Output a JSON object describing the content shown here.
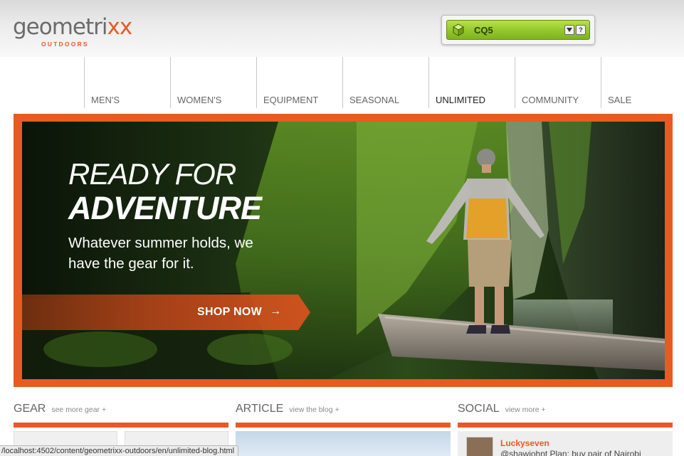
{
  "brand": {
    "logo_prefix": "geometri",
    "logo_suffix": "xx",
    "logo_sub": "OUTDOORS",
    "accent_color": "#e85a24"
  },
  "cq_widget": {
    "label": "CQ5",
    "icon": "cube-icon",
    "dropdown_icon": "chevron-down-icon",
    "help_label": "?"
  },
  "nav": {
    "items": [
      {
        "label": "MEN'S"
      },
      {
        "label": "WOMEN'S"
      },
      {
        "label": "EQUIPMENT"
      },
      {
        "label": "SEASONAL"
      },
      {
        "label": "UNLIMITED"
      },
      {
        "label": "COMMUNITY"
      },
      {
        "label": "SALE"
      }
    ]
  },
  "hero": {
    "line1": "READY FOR",
    "line2": "ADVENTURE",
    "tagline": "Whatever summer holds, we have the gear for it.",
    "cta_label": "SHOP NOW",
    "cta_icon": "arrow-right-icon",
    "cta_arrow": "→"
  },
  "sections": {
    "gear": {
      "title": "GEAR",
      "more": "see more gear +"
    },
    "article": {
      "title": "ARTICLE",
      "more": "view the blog +"
    },
    "social": {
      "title": "SOCIAL",
      "more": "view more +",
      "user": "Luckyseven",
      "tweet": "@shawjohnt Plan: buy pair of Nairobi"
    }
  },
  "status_bar": {
    "url": "/localhost:4502/content/geometrixx-outdoors/en/unlimited-blog.html"
  }
}
